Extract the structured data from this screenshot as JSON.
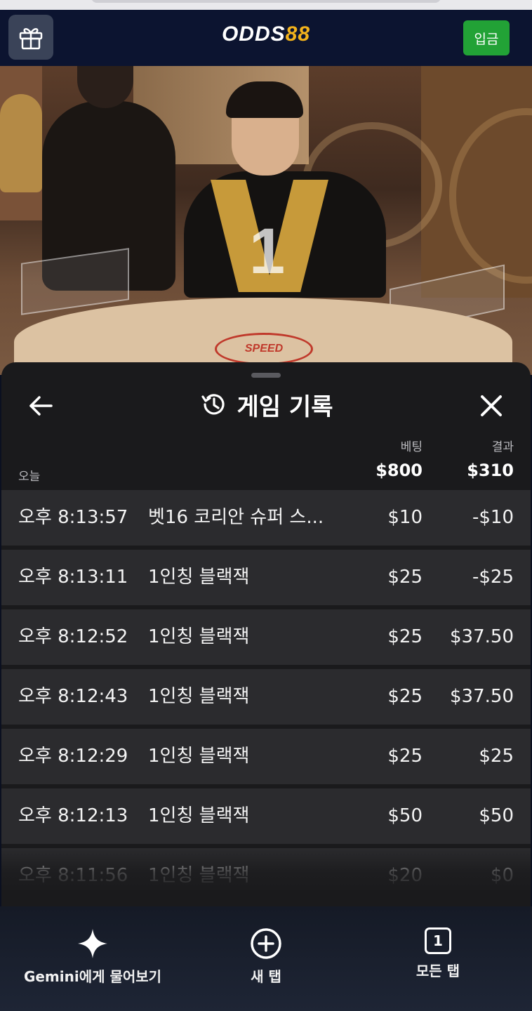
{
  "header": {
    "logo_part1": "ODDS",
    "logo_part2": "88",
    "deposit_label": "입금"
  },
  "video": {
    "countdown": "1",
    "table_brand": "SPEED"
  },
  "history": {
    "title": "게임 기록",
    "col_bet": "베팅",
    "col_result": "결과",
    "today_label": "오늘",
    "total_bet": "$800",
    "total_result": "$310",
    "rows": [
      {
        "time": "오후 8:13:57",
        "game": "벳16 코리안 슈퍼 스...",
        "bet": "$10",
        "result": "-$10"
      },
      {
        "time": "오후 8:13:11",
        "game": "1인칭 블랙잭",
        "bet": "$25",
        "result": "-$25"
      },
      {
        "time": "오후 8:12:52",
        "game": "1인칭 블랙잭",
        "bet": "$25",
        "result": "$37.50"
      },
      {
        "time": "오후 8:12:43",
        "game": "1인칭 블랙잭",
        "bet": "$25",
        "result": "$37.50"
      },
      {
        "time": "오후 8:12:29",
        "game": "1인칭 블랙잭",
        "bet": "$25",
        "result": "$25"
      },
      {
        "time": "오후 8:12:13",
        "game": "1인칭 블랙잭",
        "bet": "$50",
        "result": "$50"
      },
      {
        "time": "오후 8:11:56",
        "game": "1인칭 블랙잭",
        "bet": "$20",
        "result": "$0"
      }
    ]
  },
  "browser_bar": {
    "gemini_label": "Gemini에게 물어보기",
    "new_tab_label": "새 탭",
    "all_tabs_label": "모든 탭",
    "tab_count": "1"
  },
  "colors": {
    "header_bg": "#0c1430",
    "deposit_green": "#22a236",
    "logo_yellow": "#f2b21c",
    "sheet_bg": "#1a1a1c",
    "row_bg": "#2b2b2e"
  }
}
